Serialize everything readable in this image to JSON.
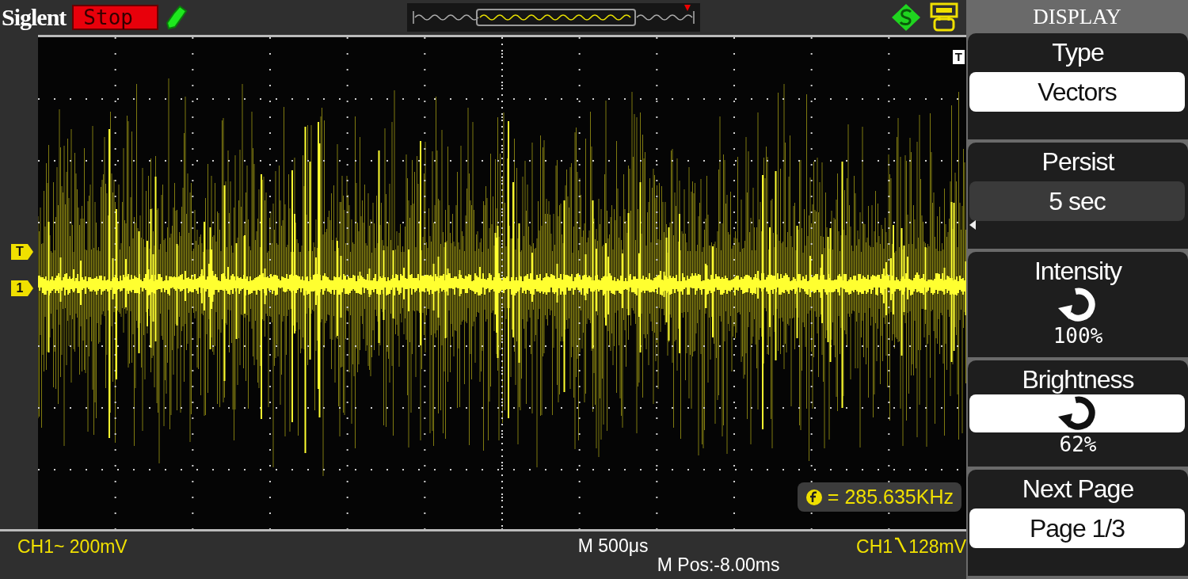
{
  "header": {
    "brand": "Siglent",
    "run_status": {
      "label": "Stop",
      "kind": "stop"
    }
  },
  "screen": {
    "markers": [
      {
        "label": "T",
        "kind": "trigger"
      },
      {
        "label": "1",
        "kind": "channel"
      }
    ],
    "corner_marker": "T",
    "frequency": "= 285.635KHz"
  },
  "footer": {
    "channel": "CH1~ 200mV",
    "timebase": "M 500μs",
    "position": "M Pos:-8.00ms",
    "trigger_source": "CH1",
    "trigger_level": "128mV"
  },
  "menu": {
    "title": "DISPLAY",
    "items": [
      {
        "kind": "option",
        "label": "Type",
        "value": "Vectors",
        "highlighted": true,
        "focused": false
      },
      {
        "kind": "option",
        "label": "Persist",
        "value": "5 sec",
        "highlighted": false,
        "focused": true
      },
      {
        "kind": "knob",
        "label": "Intensity",
        "value": "100%",
        "highlighted": false
      },
      {
        "kind": "knob",
        "label": "Brightness",
        "value": "62%",
        "highlighted": true
      },
      {
        "kind": "option",
        "label": "Next Page",
        "value": "Page 1/3",
        "highlighted": true,
        "focused": false
      }
    ]
  }
}
